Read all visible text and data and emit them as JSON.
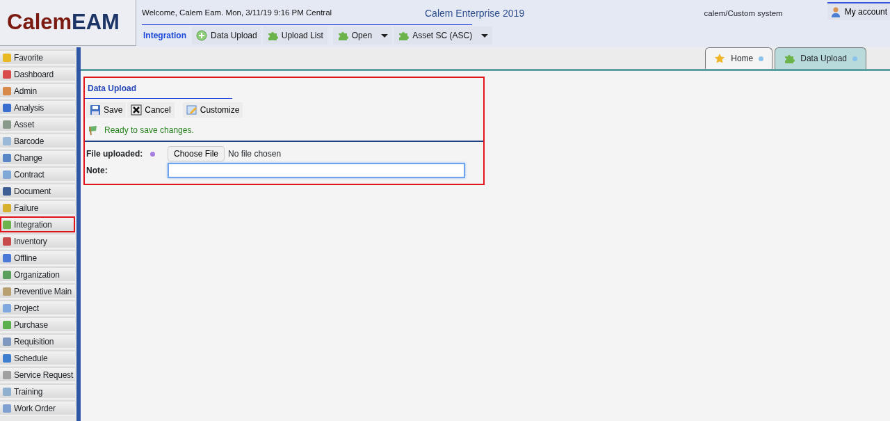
{
  "logo": {
    "part_1": "Calem",
    "part_2": "EAM"
  },
  "header": {
    "welcome": "Welcome, Calem Eam. Mon, 3/11/19 9:16 PM Central",
    "product": "Calem Enterprise 2019",
    "system": "calem/Custom system",
    "account": "My account"
  },
  "toolbar": {
    "module": "Integration",
    "items": [
      {
        "label": "Data Upload",
        "kind": "button"
      },
      {
        "label": "Upload List",
        "kind": "button"
      },
      {
        "label": "Open",
        "kind": "dropdown"
      },
      {
        "label": "Asset SC (ASC)",
        "kind": "dropdown"
      }
    ]
  },
  "sidebar": {
    "items": [
      {
        "label": "Favorite",
        "selected": false
      },
      {
        "label": "Dashboard",
        "selected": false
      },
      {
        "label": "Admin",
        "selected": false
      },
      {
        "label": "Analysis",
        "selected": false
      },
      {
        "label": "Asset",
        "selected": false
      },
      {
        "label": "Barcode",
        "selected": false
      },
      {
        "label": "Change",
        "selected": false
      },
      {
        "label": "Contract",
        "selected": false
      },
      {
        "label": "Document",
        "selected": false
      },
      {
        "label": "Failure",
        "selected": false
      },
      {
        "label": "Integration",
        "selected": true
      },
      {
        "label": "Inventory",
        "selected": false
      },
      {
        "label": "Offline",
        "selected": false
      },
      {
        "label": "Organization",
        "selected": false
      },
      {
        "label": "Preventive Main",
        "selected": false
      },
      {
        "label": "Project",
        "selected": false
      },
      {
        "label": "Purchase",
        "selected": false
      },
      {
        "label": "Requisition",
        "selected": false
      },
      {
        "label": "Schedule",
        "selected": false
      },
      {
        "label": "Service Request",
        "selected": false
      },
      {
        "label": "Training",
        "selected": false
      },
      {
        "label": "Work Order",
        "selected": false
      }
    ]
  },
  "tabs": [
    {
      "label": "Home",
      "selected": false
    },
    {
      "label": "Data Upload",
      "selected": true
    }
  ],
  "form": {
    "title": "Data Upload",
    "highlighted": true,
    "actions": [
      "Save",
      "Cancel",
      "Customize"
    ],
    "status": "Ready to save changes.",
    "fields": [
      {
        "label": "File uploaded:",
        "kind": "file",
        "required": true,
        "button": "Choose File",
        "value": "No file chosen"
      },
      {
        "label": "Note:",
        "kind": "text",
        "focused": true
      }
    ]
  }
}
